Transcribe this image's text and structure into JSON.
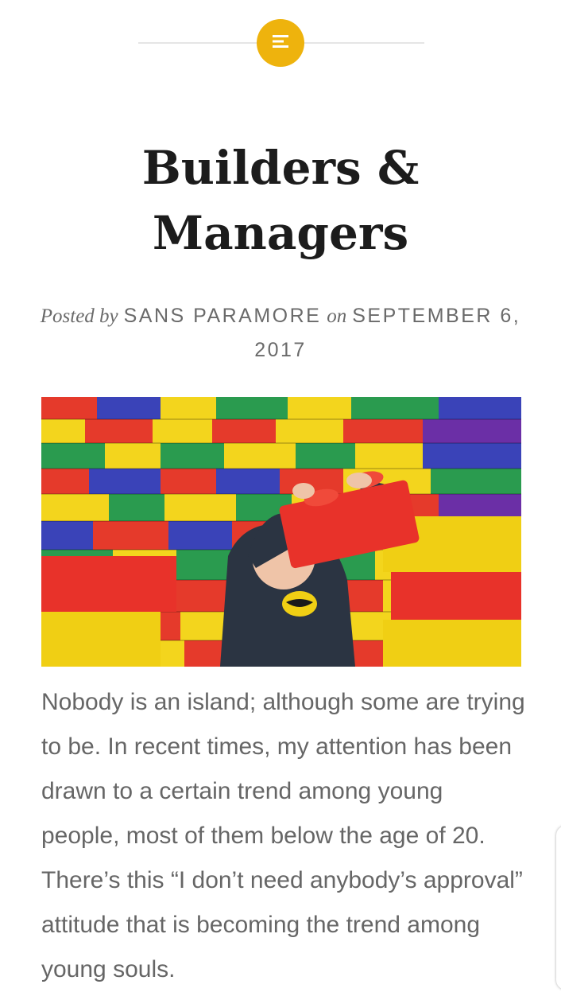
{
  "post": {
    "format_icon": "standard-post-icon",
    "title_line1": "Builders &",
    "title_line2": "Managers",
    "meta": {
      "posted_by_label": "Posted by",
      "author": "SANS PARAMORE",
      "on_label": "on",
      "date": "SEPTEMBER 6, 2017"
    },
    "featured_image_alt": "",
    "body": "Nobody is an island; although some are trying to be. In recent times, my attention has been drawn to a certain trend among young people, most of them below the age of 20. There’s this “I don’t need anybody’s approval” attitude that is becoming the trend among young souls."
  },
  "colors": {
    "accent": "#eeb30d",
    "title": "#1c1c1c",
    "meta": "#6a6a6a",
    "body": "#666666"
  }
}
